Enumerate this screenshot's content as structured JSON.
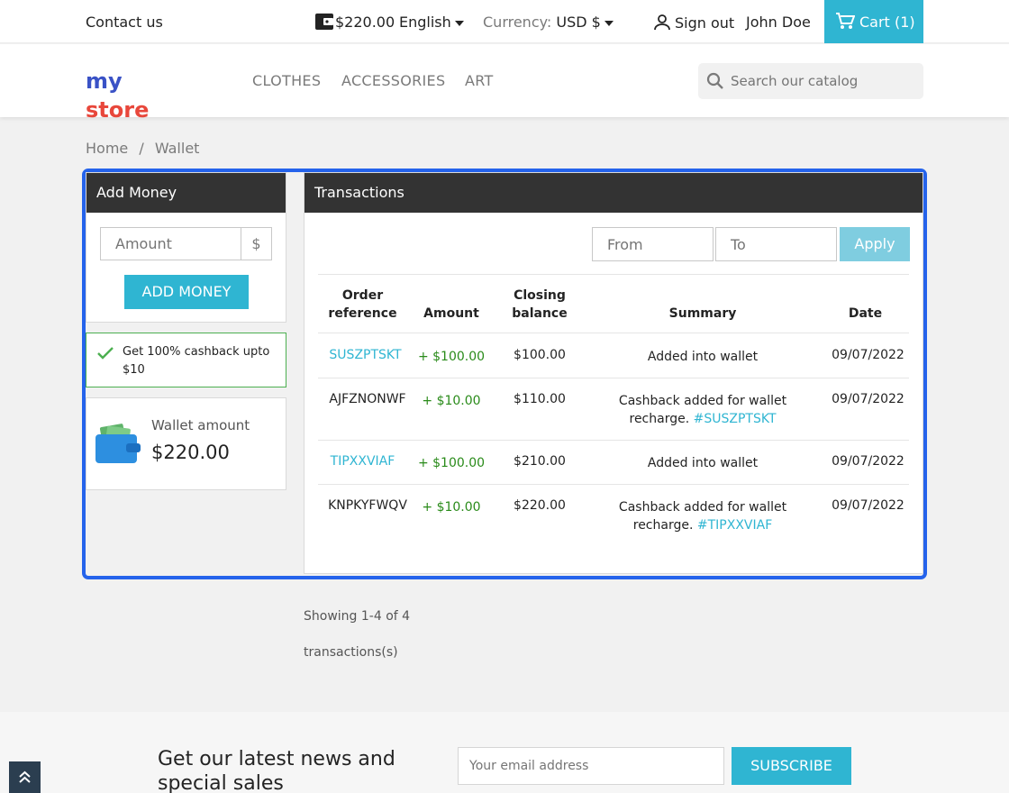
{
  "topbar": {
    "contact": "Contact us",
    "wallet_balance": "$220.00",
    "language": "English",
    "currency_label": "Currency:",
    "currency_value": "USD $",
    "sign_out": "Sign out",
    "user_name": "John Doe",
    "cart_label": "Cart",
    "cart_count": "(1)"
  },
  "header": {
    "logo_text_my": "my",
    "logo_text_store": "store",
    "nav": [
      "CLOTHES",
      "ACCESSORIES",
      "ART"
    ],
    "search_placeholder": "Search our catalog"
  },
  "breadcrumb": {
    "home": "Home",
    "separator": "/",
    "current": "Wallet"
  },
  "add_money": {
    "title": "Add Money",
    "amount_placeholder": "Amount",
    "currency_symbol": "$",
    "button": "ADD MONEY",
    "cashback": "Get 100% cashback upto $10"
  },
  "wallet": {
    "label": "Wallet amount",
    "amount": "$220.00"
  },
  "transactions": {
    "title": "Transactions",
    "from_placeholder": "From",
    "to_placeholder": "To",
    "apply": "Apply",
    "columns": {
      "ref": "Order reference",
      "amount": "Amount",
      "closing": "Closing balance",
      "summary": "Summary",
      "date": "Date"
    },
    "rows": [
      {
        "ref": "SUSZPTSKT",
        "amount": "+ $100.00",
        "closing": "$100.00",
        "summary": "Added into wallet",
        "summary_link": "",
        "date": "09/07/2022"
      },
      {
        "ref": "AJFZNONWF",
        "amount": "+ $10.00",
        "closing": "$110.00",
        "summary": "Cashback added for wallet recharge.",
        "summary_link": "#SUSZPTSKT",
        "date": "09/07/2022"
      },
      {
        "ref": "TIPXXVIAF",
        "amount": "+ $100.00",
        "closing": "$210.00",
        "summary": "Added into wallet",
        "summary_link": "",
        "date": "09/07/2022"
      },
      {
        "ref": "KNPKYFWQV",
        "amount": "+ $10.00",
        "closing": "$220.00",
        "summary": "Cashback added for wallet recharge.",
        "summary_link": "#TIPXXVIAF",
        "date": "09/07/2022"
      }
    ],
    "showing_line1": "Showing 1-4 of 4",
    "showing_line2": "transactions(s)"
  },
  "footer": {
    "newsletter_title": "Get our latest news and special sales",
    "email_placeholder": "Your email address",
    "subscribe": "SUBSCRIBE"
  },
  "colors": {
    "accent": "#2fb5d2",
    "dark_header": "#333333",
    "highlight_frame": "#2563eb",
    "positive": "#2a8b1a"
  }
}
